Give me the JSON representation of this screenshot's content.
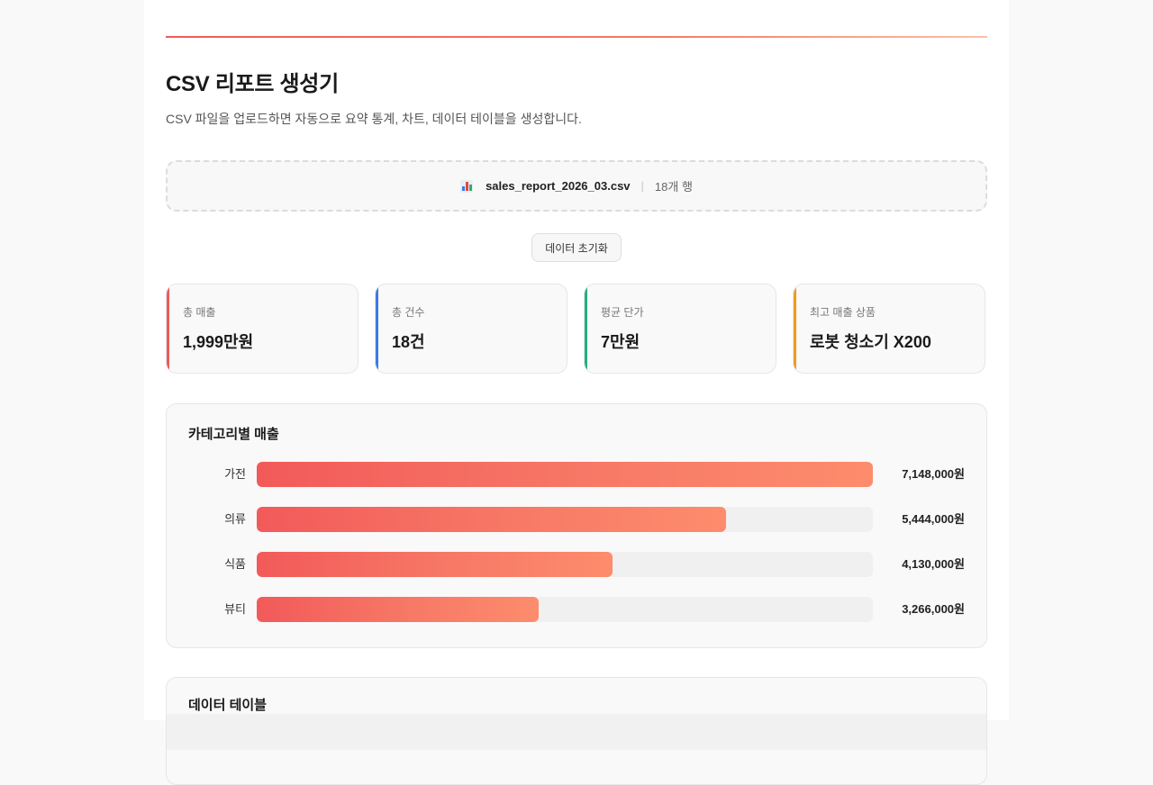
{
  "header": {
    "title": "CSV 리포트 생성기",
    "subtitle": "CSV 파일을 업로드하면 자동으로 요약 통계, 차트, 데이터 테이블을 생성합니다."
  },
  "upload": {
    "icon": "bar-chart-icon",
    "file_name": "sales_report_2026_03.csv",
    "separator": "|",
    "row_count": "18개 행"
  },
  "actions": {
    "reset_label": "데이터 초기화"
  },
  "stats": [
    {
      "label": "총 매출",
      "value": "1,999만원",
      "color": "#f05a5a"
    },
    {
      "label": "총 건수",
      "value": "18건",
      "color": "#3b7be8"
    },
    {
      "label": "평균 단가",
      "value": "7만원",
      "color": "#22b07d"
    },
    {
      "label": "최고 매출 상품",
      "value": "로봇 청소기 X200",
      "color": "#f29a1f"
    }
  ],
  "category_chart": {
    "title": "카테고리별 매출",
    "rows": [
      {
        "label": "가전",
        "value_text": "7,148,000원"
      },
      {
        "label": "의류",
        "value_text": "5,444,000원"
      },
      {
        "label": "식품",
        "value_text": "4,130,000원"
      },
      {
        "label": "뷰티",
        "value_text": "3,266,000원"
      }
    ]
  },
  "chart_data": {
    "type": "bar",
    "orientation": "horizontal",
    "title": "카테고리별 매출",
    "categories": [
      "가전",
      "의류",
      "식품",
      "뷰티"
    ],
    "values": [
      7148000,
      5444000,
      4130000,
      3266000
    ],
    "value_labels": [
      "7,148,000원",
      "5,444,000원",
      "4,130,000원",
      "3,266,000원"
    ],
    "xlim": [
      0,
      7148000
    ],
    "grid": false,
    "legend": "none"
  },
  "data_table": {
    "title": "데이터 테이블"
  }
}
